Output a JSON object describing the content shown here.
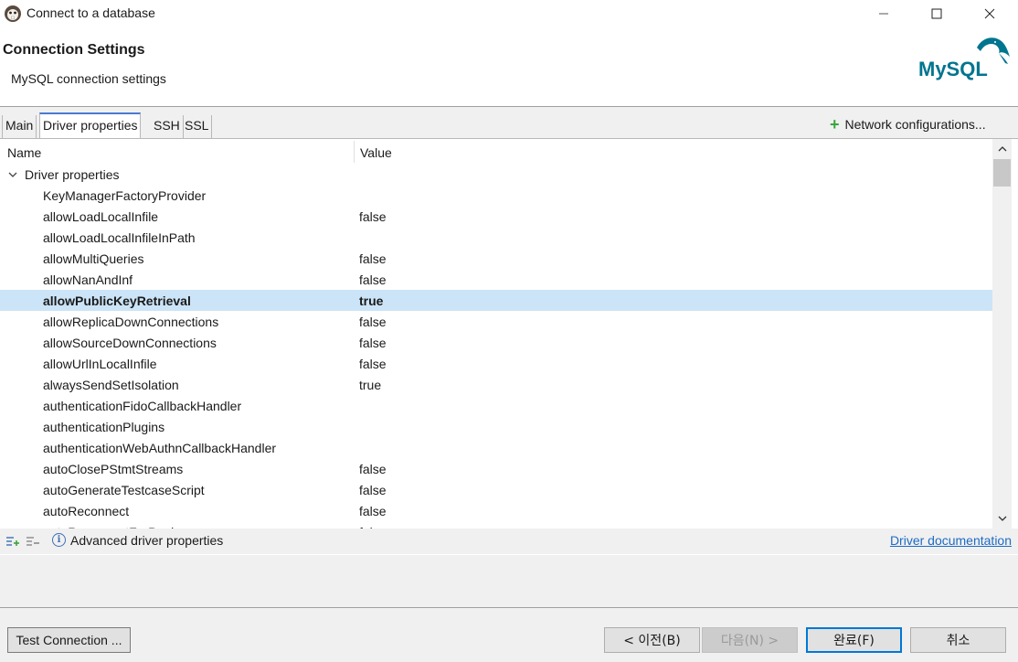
{
  "window": {
    "title": "Connect to a database"
  },
  "header": {
    "title": "Connection Settings",
    "subtitle": "MySQL connection settings",
    "logo_text": "MySQL"
  },
  "tabs": [
    {
      "label": "Main",
      "active": false
    },
    {
      "label": "Driver properties",
      "active": true
    },
    {
      "label": "SSH",
      "active": false
    },
    {
      "label": "SSL",
      "active": false
    }
  ],
  "network_config_label": "Network configurations...",
  "table": {
    "columns": {
      "name": "Name",
      "value": "Value"
    },
    "group_label": "Driver properties",
    "rows": [
      {
        "name": "KeyManagerFactoryProvider",
        "value": ""
      },
      {
        "name": "allowLoadLocalInfile",
        "value": "false"
      },
      {
        "name": "allowLoadLocalInfileInPath",
        "value": ""
      },
      {
        "name": "allowMultiQueries",
        "value": "false"
      },
      {
        "name": "allowNanAndInf",
        "value": "false"
      },
      {
        "name": "allowPublicKeyRetrieval",
        "value": "true",
        "selected": true
      },
      {
        "name": "allowReplicaDownConnections",
        "value": "false"
      },
      {
        "name": "allowSourceDownConnections",
        "value": "false"
      },
      {
        "name": "allowUrlInLocalInfile",
        "value": "false"
      },
      {
        "name": "alwaysSendSetIsolation",
        "value": "true"
      },
      {
        "name": "authenticationFidoCallbackHandler",
        "value": ""
      },
      {
        "name": "authenticationPlugins",
        "value": ""
      },
      {
        "name": "authenticationWebAuthnCallbackHandler",
        "value": ""
      },
      {
        "name": "autoClosePStmtStreams",
        "value": "false"
      },
      {
        "name": "autoGenerateTestcaseScript",
        "value": "false"
      },
      {
        "name": "autoReconnect",
        "value": "false"
      },
      {
        "name": "autoReconnectForPools",
        "value": "false"
      }
    ]
  },
  "bottom_bar": {
    "advanced_label": "Advanced driver properties",
    "doc_link": "Driver documentation"
  },
  "buttons": {
    "test_connection": "Test Connection ...",
    "prev": "< 이전(B)",
    "next": "다음(N) >",
    "finish": "완료(F)",
    "cancel": "취소"
  },
  "colors": {
    "selection": "#cce4f7",
    "link": "#1e6bc4",
    "focus_border": "#0078d7",
    "mysql_blue": "#00758f",
    "mysql_orange": "#f29111"
  }
}
